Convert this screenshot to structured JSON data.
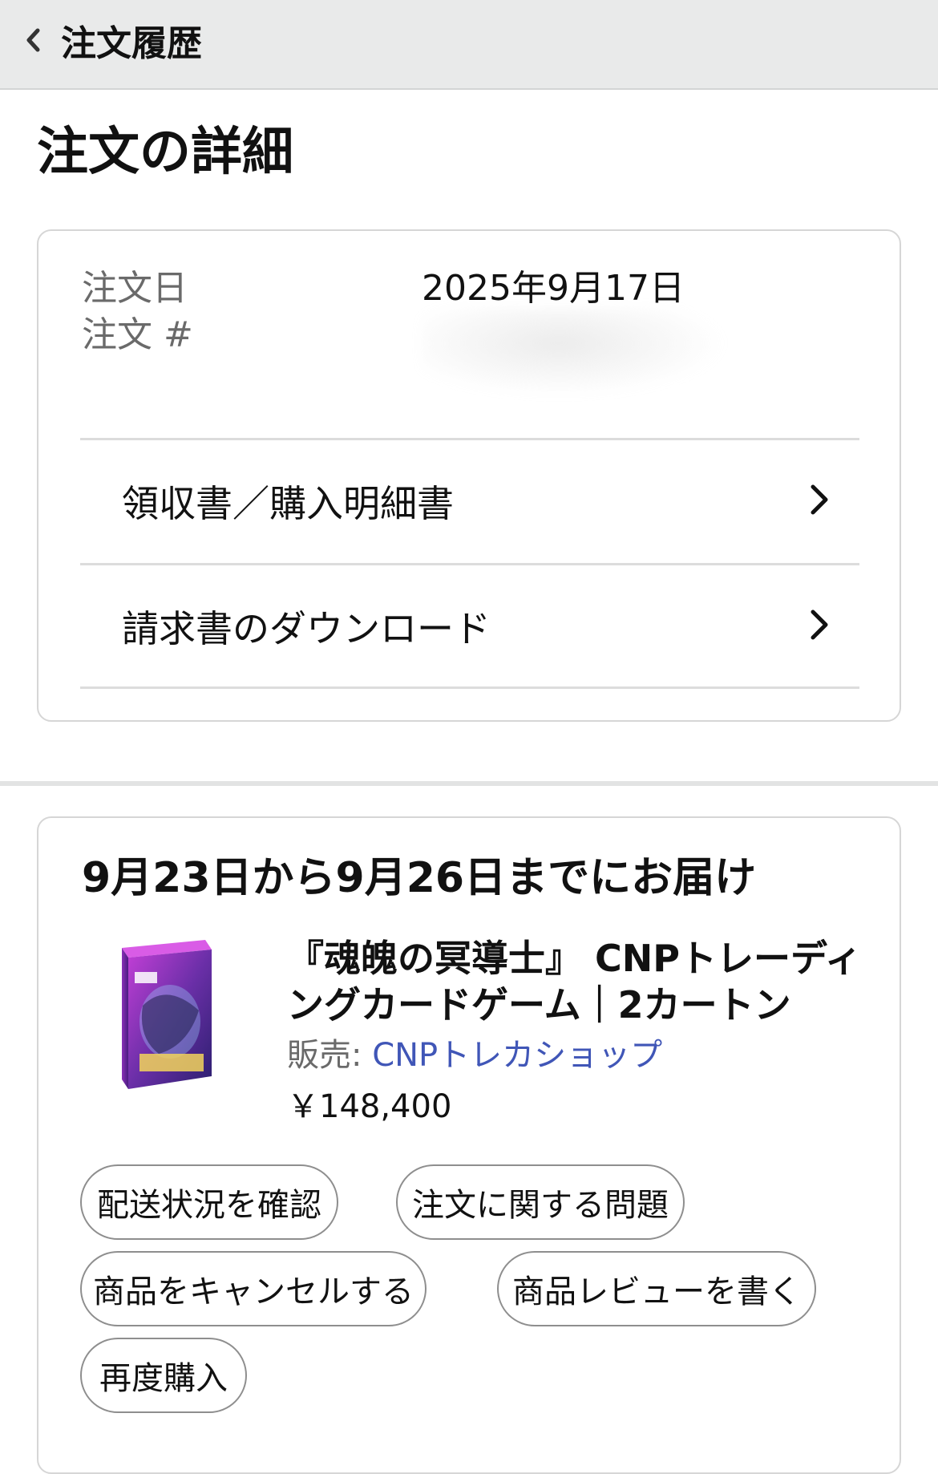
{
  "nav": {
    "back_label": "注文履歴"
  },
  "page_title": "注文の詳細",
  "order": {
    "date_label": "注文日",
    "date_value": "2025年9月17日",
    "number_label": "注文 #"
  },
  "links": [
    {
      "label": "領収書／購入明細書"
    },
    {
      "label": "請求書のダウンロード"
    }
  ],
  "shipment": {
    "delivery_text": "9月23日から9月26日までにお届け",
    "product_title": "『魂魄の冥導士』 CNPトレーディングカードゲーム｜2カートン",
    "seller_prefix": "販売: ",
    "seller_name": "CNPトレカショップ",
    "price": "￥148,400"
  },
  "actions": {
    "track": "配送状況を確認",
    "problem": "注文に関する問題",
    "cancel": "商品をキャンセルする",
    "review": "商品レビューを書く",
    "rebuy": "再度購入"
  },
  "colors": {
    "link": "#4056b7",
    "topbar": "#e9eaea",
    "border": "#d6d6d6"
  },
  "icons": {
    "back": "chevron-left-icon",
    "row": "chevron-right-icon"
  }
}
